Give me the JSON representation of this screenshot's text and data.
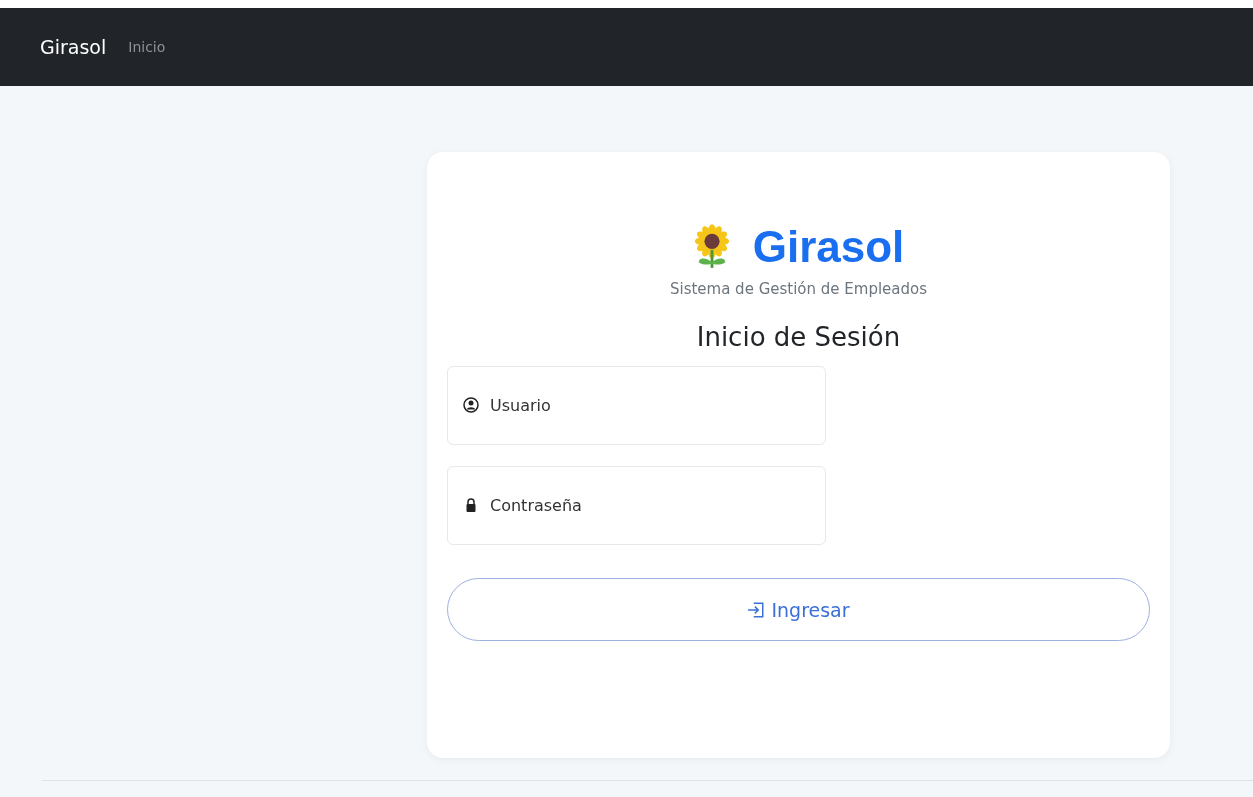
{
  "navbar": {
    "brand": "Girasol",
    "links": [
      {
        "label": "Inicio"
      }
    ]
  },
  "login": {
    "logo_title": "Girasol",
    "subtitle": "Sistema de Gestión de Empleados",
    "heading": "Inicio de Sesión",
    "fields": [
      {
        "kind": "user",
        "placeholder": "Usuario"
      },
      {
        "kind": "password",
        "placeholder": "Contraseña"
      }
    ],
    "submit": "Ingresar"
  }
}
